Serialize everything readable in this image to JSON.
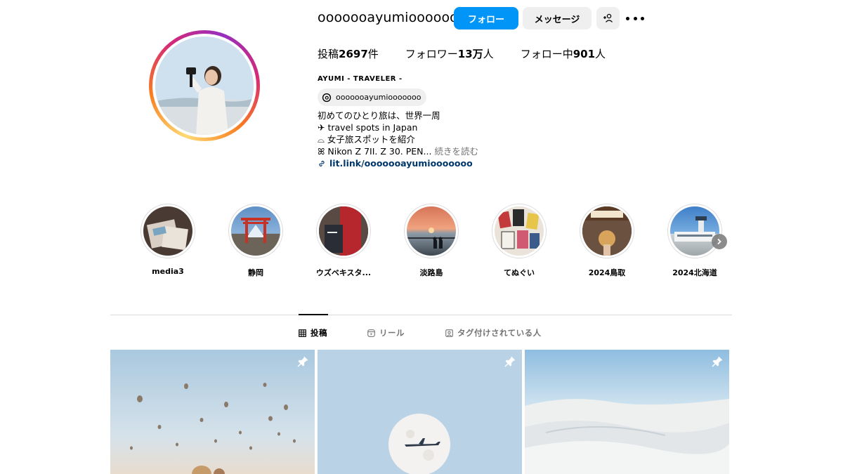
{
  "profile": {
    "username": "ooooooayumiooooooo",
    "follow_label": "フォロー",
    "message_label": "メッセージ",
    "add_user_icon": "person-plus-icon",
    "more_icon": "more-options-icon",
    "stats": {
      "posts_prefix": "投稿",
      "posts_count": "2697",
      "posts_suffix": "件",
      "followers_prefix": "フォロワー",
      "followers_count": "13万",
      "followers_suffix": "人",
      "following_prefix": "フォロー中",
      "following_count": "901",
      "following_suffix": "人"
    },
    "full_name": "AYUMI - TRAVELER -",
    "threads_handle": "ooooooayumiooooooo",
    "bio_lines": [
      "初めてのひとり旅は、世界一周",
      "✈ travel spots in Japan",
      "⌓ 女子旅スポットを紹介",
      "ꕤ Nikon Z 7II. Z 30. PEN..."
    ],
    "more_label": "続きを読む",
    "link": "lit.link/ooooooayumiooooooo"
  },
  "highlights": [
    {
      "label": "media3"
    },
    {
      "label": "静岡"
    },
    {
      "label": "ウズベキスタ..."
    },
    {
      "label": "淡路島"
    },
    {
      "label": "てぬぐい"
    },
    {
      "label": "2024鳥取"
    },
    {
      "label": "2024北海道"
    }
  ],
  "tabs": {
    "posts": "投稿",
    "reels": "リール",
    "tagged": "タグ付けされている人"
  },
  "colors": {
    "follow_button": "#0095f6",
    "secondary_button": "#efefef",
    "link": "#00376b",
    "muted": "#737373"
  }
}
